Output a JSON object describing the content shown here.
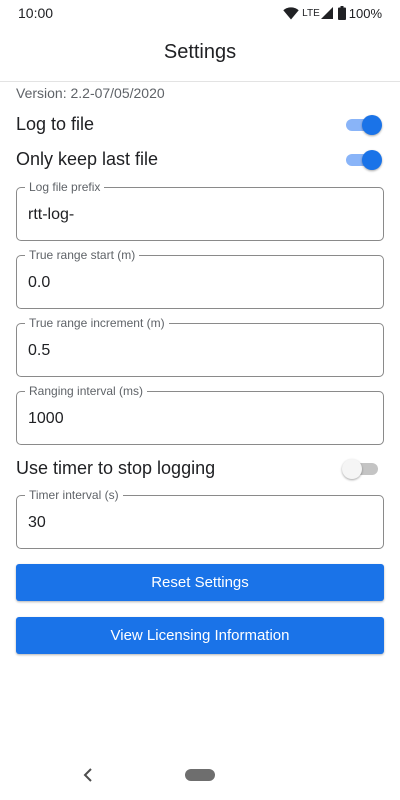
{
  "status_bar": {
    "time": "10:00",
    "network": "LTE",
    "battery": "100%",
    "icons": [
      "wifi-icon",
      "signal-icon",
      "battery-icon"
    ]
  },
  "app_bar": {
    "title": "Settings"
  },
  "version": "Version: 2.2-07/05/2020",
  "toggles": {
    "log_to_file": {
      "label": "Log to file",
      "on": true
    },
    "only_keep_last_file": {
      "label": "Only keep last file",
      "on": true
    },
    "use_timer": {
      "label": "Use timer to stop logging",
      "on": false
    }
  },
  "fields": {
    "log_file_prefix": {
      "label": "Log file prefix",
      "value": "rtt-log-"
    },
    "true_range_start": {
      "label": "True range start (m)",
      "value": "0.0"
    },
    "true_range_increment": {
      "label": "True range increment (m)",
      "value": "0.5"
    },
    "ranging_interval": {
      "label": "Ranging interval (ms)",
      "value": "1000"
    },
    "timer_interval": {
      "label": "Timer interval (s)",
      "value": "30"
    }
  },
  "buttons": {
    "reset": "Reset Settings",
    "licensing": "View Licensing Information"
  },
  "nav": {
    "icons": [
      "back-icon",
      "home-pill"
    ]
  },
  "colors": {
    "accent": "#1a73e8",
    "switch_track_on": "#89b4f8",
    "switch_off": "#c4c4c4"
  }
}
